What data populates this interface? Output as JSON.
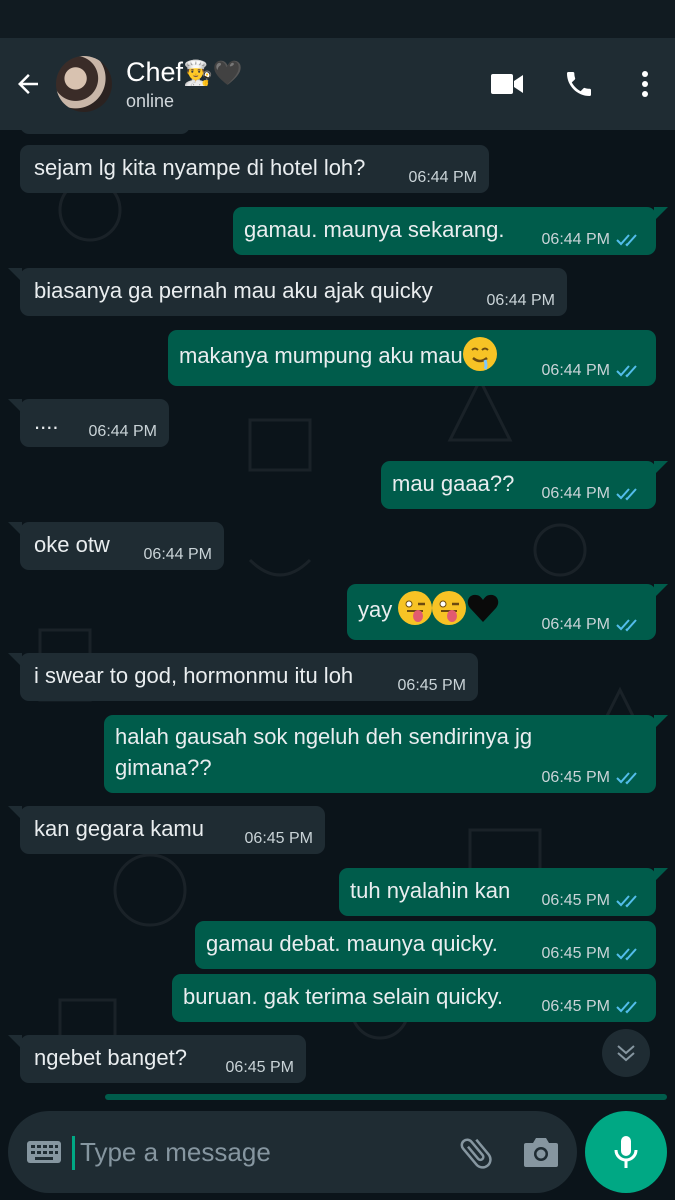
{
  "header": {
    "contact_name": "Chef",
    "contact_name_emojis": "👨‍🍳🖤",
    "status": "online"
  },
  "messages": [
    {
      "dir": "in",
      "text": "sejam lg kita nyampe di hotel loh?",
      "time": "06:44 PM"
    },
    {
      "dir": "out",
      "text": "gamau. maunya sekarang.",
      "time": "06:44 PM",
      "ticks": "read"
    },
    {
      "dir": "in",
      "text": "biasanya ga pernah mau aku ajak quicky",
      "time": "06:44 PM"
    },
    {
      "dir": "out",
      "text": "makanya mumpung aku mau",
      "emoji": "drooling-face",
      "time": "06:44 PM",
      "ticks": "read"
    },
    {
      "dir": "in",
      "text": "....",
      "time": "06:44 PM"
    },
    {
      "dir": "out",
      "text": "mau gaaa??",
      "time": "06:44 PM",
      "ticks": "read"
    },
    {
      "dir": "in",
      "text": "oke otw",
      "time": "06:44 PM"
    },
    {
      "dir": "out",
      "text": "yay",
      "emoji": "winking-tongue x2, black-heart",
      "time": "06:44 PM",
      "ticks": "read"
    },
    {
      "dir": "in",
      "text": "i swear to god, hormonmu itu loh",
      "time": "06:45 PM"
    },
    {
      "dir": "out",
      "text": "halah gausah sok ngeluh deh sendirinya jg gimana??",
      "time": "06:45 PM",
      "ticks": "read"
    },
    {
      "dir": "in",
      "text": "kan gegara kamu",
      "time": "06:45 PM"
    },
    {
      "dir": "out",
      "text": "tuh nyalahin kan",
      "time": "06:45 PM",
      "ticks": "read"
    },
    {
      "dir": "out",
      "text": "gamau debat. maunya quicky.",
      "time": "06:45 PM",
      "ticks": "read"
    },
    {
      "dir": "out",
      "text": "buruan. gak terima selain quicky.",
      "time": "06:45 PM",
      "ticks": "read"
    },
    {
      "dir": "in",
      "text": "ngebet banget?",
      "time": "06:45 PM"
    }
  ],
  "composer": {
    "placeholder": "Type a message"
  },
  "icons": {
    "back": "arrow-left-icon",
    "video": "video-camera-icon",
    "call": "phone-icon",
    "menu": "more-vertical-icon",
    "keyboard": "keyboard-icon",
    "attach": "paperclip-icon",
    "camera": "camera-icon",
    "mic": "microphone-icon",
    "scroll_down": "chevron-double-down-icon"
  },
  "colors": {
    "header_bg": "#1f2c33",
    "chat_bg": "#0b141a",
    "incoming_bubble": "#1f2c33",
    "outgoing_bubble": "#005c4b",
    "read_ticks": "#53bdeb",
    "accent": "#00a884"
  }
}
